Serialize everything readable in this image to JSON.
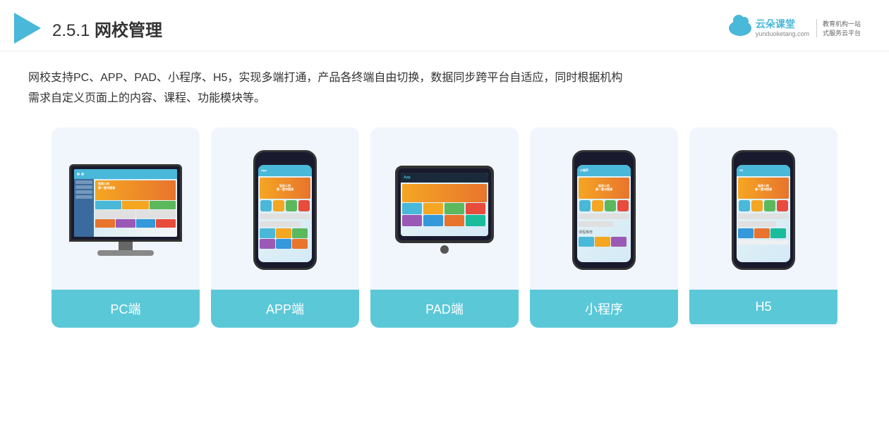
{
  "header": {
    "title_prefix": "2.5.1 ",
    "title_bold": "网校管理",
    "brand": {
      "domain": "yunduoketang.com",
      "name": "云朵课堂",
      "tagline1": "教育机构一站",
      "tagline2": "式服务云平台"
    }
  },
  "description": {
    "line1": "网校支持PC、APP、PAD、小程序、H5，实现多端打通，产品各终端自由切换，数据同步跨平台自适应，同时根据机构",
    "line2": "需求自定义页面上的内容、课程、功能模块等。"
  },
  "cards": [
    {
      "id": "pc",
      "label": "PC端"
    },
    {
      "id": "app",
      "label": "APP端"
    },
    {
      "id": "pad",
      "label": "PAD端"
    },
    {
      "id": "miniapp",
      "label": "小程序"
    },
    {
      "id": "h5",
      "label": "H5"
    }
  ]
}
